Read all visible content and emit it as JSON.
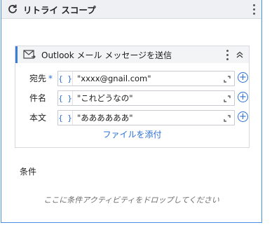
{
  "scope": {
    "title": "リトライ スコープ",
    "icon": "refresh-icon"
  },
  "activity": {
    "title": "Outlook メール メッセージを送信",
    "icon": "mail-icon",
    "accent": "#3c7bd9",
    "fields": [
      {
        "label": "宛先",
        "required_mark": "*",
        "value": "\"xxxx@gnail.com\""
      },
      {
        "label": "件名",
        "required_mark": "",
        "value": "\"これどうなの\""
      },
      {
        "label": "本文",
        "required_mark": "",
        "value": "\"ああああああ\""
      }
    ],
    "braces": "{ }",
    "attach_link": "ファイルを添付"
  },
  "condition": {
    "label": "条件",
    "drop_hint": "ここに条件アクティビティをドロップしてください"
  }
}
